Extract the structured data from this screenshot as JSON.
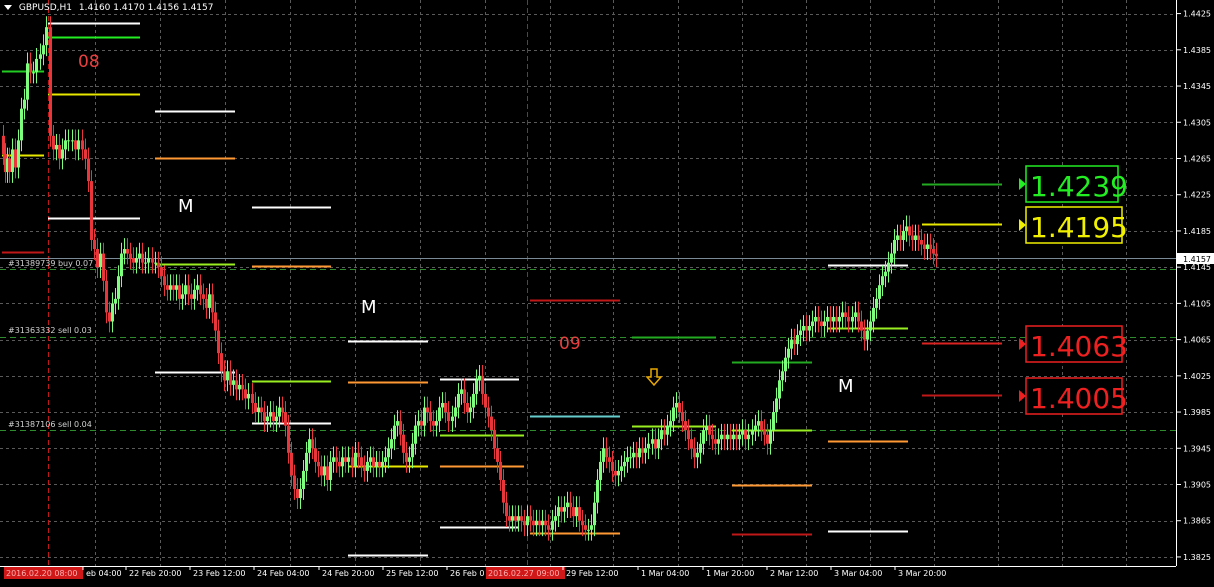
{
  "header": {
    "symbol_tf": "GBPUSD,H1",
    "ohlc": "1.4160 1.4170 1.4156 1.4157"
  },
  "price_axis": {
    "labels": [
      "1.4425",
      "1.4385",
      "1.4345",
      "1.4305",
      "1.4265",
      "1.4225",
      "1.4185",
      "1.4145",
      "1.4105",
      "1.4065",
      "1.4025",
      "1.3985",
      "1.3945",
      "1.3905",
      "1.3865",
      "1.3825"
    ],
    "current_price": "1.4157"
  },
  "time_axis": {
    "labels": [
      "2016.02.20 08:00",
      "eb 04:00",
      "22 Feb 20:00",
      "23 Feb 12:00",
      "24 Feb 04:00",
      "24 Feb 20:00",
      "25 Feb 12:00",
      "26 Feb 0",
      "2016.02.27 09:00",
      "29 Feb 12:00",
      "1 Mar 04:00",
      "1 Mar 20:00",
      "2 Mar 12:00",
      "3 Mar 04:00",
      "3 Mar 20:00"
    ]
  },
  "orders": {
    "buy": "#31389739 buy 0.07",
    "sell1": "#31363332 sell 0.03",
    "sell2": "#31387106 sell 0.04"
  },
  "labels": {
    "week1": "08",
    "week2": "09",
    "m1": "M",
    "m2": "M",
    "m3": "M"
  },
  "price_boxes": {
    "green": "1.4239",
    "yellow": "1.4195",
    "red1": "1.4063",
    "red2": "1.4005"
  },
  "chart_data": {
    "type": "candlestick",
    "symbol": "GBPUSD",
    "timeframe": "H1",
    "ylim": [
      1.3815,
      1.444
    ],
    "current_price": 1.4157,
    "points": [
      [
        1,
        1.429
      ],
      [
        3,
        1.427
      ],
      [
        5,
        1.425
      ],
      [
        7,
        1.4265
      ],
      [
        9,
        1.425
      ],
      [
        12,
        1.4275
      ],
      [
        15,
        1.4255
      ],
      [
        18,
        1.4285
      ],
      [
        21,
        1.432
      ],
      [
        24,
        1.433
      ],
      [
        27,
        1.437
      ],
      [
        30,
        1.436
      ],
      [
        33,
        1.436
      ],
      [
        36,
        1.4375
      ],
      [
        40,
        1.438
      ],
      [
        43,
        1.439
      ],
      [
        46,
        1.441
      ],
      [
        50,
        1.429
      ],
      [
        53,
        1.4275
      ],
      [
        56,
        1.428
      ],
      [
        59,
        1.4265
      ],
      [
        62,
        1.4275
      ],
      [
        65,
        1.4285
      ],
      [
        68,
        1.4285
      ],
      [
        72,
        1.4285
      ],
      [
        75,
        1.4275
      ],
      [
        78,
        1.4285
      ],
      [
        82,
        1.4275
      ],
      [
        85,
        1.4265
      ],
      [
        88,
        1.424
      ],
      [
        91,
        1.4175
      ],
      [
        94,
        1.4165
      ],
      [
        97,
        1.4145
      ],
      [
        100,
        1.416
      ],
      [
        103,
        1.413
      ],
      [
        106,
        1.4095
      ],
      [
        109,
        1.4085
      ],
      [
        112,
        1.4105
      ],
      [
        115,
        1.411
      ],
      [
        118,
        1.4135
      ],
      [
        121,
        1.416
      ],
      [
        124,
        1.4165
      ],
      [
        127,
        1.416
      ],
      [
        130,
        1.4155
      ],
      [
        133,
        1.415
      ],
      [
        136,
        1.4155
      ],
      [
        139,
        1.416
      ],
      [
        142,
        1.415
      ],
      [
        145,
        1.415
      ],
      [
        148,
        1.4155
      ],
      [
        152,
        1.415
      ],
      [
        155,
        1.415
      ],
      [
        158,
        1.4145
      ],
      [
        161,
        1.4135
      ],
      [
        164,
        1.4125
      ],
      [
        167,
        1.412
      ],
      [
        170,
        1.4125
      ],
      [
        173,
        1.412
      ],
      [
        176,
        1.4125
      ],
      [
        179,
        1.411
      ],
      [
        182,
        1.4115
      ],
      [
        185,
        1.4125
      ],
      [
        188,
        1.4115
      ],
      [
        191,
        1.411
      ],
      [
        194,
        1.412
      ],
      [
        197,
        1.4125
      ],
      [
        200,
        1.4115
      ],
      [
        203,
        1.411
      ],
      [
        206,
        1.41
      ],
      [
        209,
        1.4115
      ],
      [
        212,
        1.4095
      ],
      [
        215,
        1.4075
      ],
      [
        218,
        1.405
      ],
      [
        221,
        1.403
      ],
      [
        224,
        1.402
      ],
      [
        227,
        1.403
      ],
      [
        230,
        1.4015
      ],
      [
        233,
        1.402
      ],
      [
        236,
        1.401
      ],
      [
        239,
        1.4015
      ],
      [
        242,
        1.401
      ],
      [
        245,
        1.4
      ],
      [
        248,
        1.4005
      ],
      [
        252,
        1.3995
      ],
      [
        255,
        1.3985
      ],
      [
        258,
        1.399
      ],
      [
        261,
        1.3985
      ],
      [
        264,
        1.3975
      ],
      [
        267,
        1.398
      ],
      [
        270,
        1.3985
      ],
      [
        273,
        1.3975
      ],
      [
        276,
        1.398
      ],
      [
        279,
        1.399
      ],
      [
        282,
        1.3985
      ],
      [
        285,
        1.397
      ],
      [
        288,
        1.394
      ],
      [
        291,
        1.3915
      ],
      [
        294,
        1.39
      ],
      [
        297,
        1.389
      ],
      [
        300,
        1.39
      ],
      [
        303,
        1.392
      ],
      [
        306,
        1.394
      ],
      [
        309,
        1.3955
      ],
      [
        312,
        1.3945
      ],
      [
        315,
        1.393
      ],
      [
        318,
        1.3925
      ],
      [
        321,
        1.3915
      ],
      [
        324,
        1.3925
      ],
      [
        327,
        1.391
      ],
      [
        330,
        1.393
      ],
      [
        333,
        1.3935
      ],
      [
        336,
        1.393
      ],
      [
        339,
        1.3925
      ],
      [
        342,
        1.3935
      ],
      [
        345,
        1.393
      ],
      [
        348,
        1.3935
      ],
      [
        352,
        1.3925
      ],
      [
        355,
        1.394
      ],
      [
        358,
        1.3935
      ],
      [
        361,
        1.3925
      ],
      [
        364,
        1.392
      ],
      [
        367,
        1.393
      ],
      [
        370,
        1.3935
      ],
      [
        373,
        1.3925
      ],
      [
        376,
        1.393
      ],
      [
        379,
        1.3925
      ],
      [
        382,
        1.393
      ],
      [
        385,
        1.3935
      ],
      [
        388,
        1.3945
      ],
      [
        391,
        1.3955
      ],
      [
        394,
        1.397
      ],
      [
        397,
        1.3975
      ],
      [
        400,
        1.396
      ],
      [
        403,
        1.394
      ],
      [
        406,
        1.393
      ],
      [
        409,
        1.3935
      ],
      [
        412,
        1.395
      ],
      [
        415,
        1.397
      ],
      [
        418,
        1.3975
      ],
      [
        421,
        1.397
      ],
      [
        424,
        1.399
      ],
      [
        427,
        1.3985
      ],
      [
        430,
        1.3975
      ],
      [
        433,
        1.397
      ],
      [
        436,
        1.3975
      ],
      [
        439,
        1.399
      ],
      [
        442,
        1.3995
      ],
      [
        445,
        1.3985
      ],
      [
        448,
        1.3975
      ],
      [
        452,
        1.398
      ],
      [
        455,
        1.399
      ],
      [
        458,
        1.4005
      ],
      [
        461,
        1.401
      ],
      [
        464,
        1.3995
      ],
      [
        467,
        1.3985
      ],
      [
        470,
        1.399
      ],
      [
        473,
        1.4005
      ],
      [
        476,
        1.402
      ],
      [
        479,
        1.4025
      ],
      [
        482,
        1.4005
      ],
      [
        485,
        1.399
      ],
      [
        488,
        1.398
      ],
      [
        491,
        1.3965
      ],
      [
        494,
        1.3945
      ],
      [
        497,
        1.393
      ],
      [
        500,
        1.391
      ],
      [
        503,
        1.3885
      ],
      [
        506,
        1.387
      ],
      [
        509,
        1.3865
      ],
      [
        512,
        1.387
      ],
      [
        515,
        1.3865
      ],
      [
        518,
        1.387
      ],
      [
        521,
        1.3865
      ],
      [
        524,
        1.386
      ],
      [
        527,
        1.387
      ],
      [
        530,
        1.3865
      ],
      [
        533,
        1.386
      ],
      [
        536,
        1.3865
      ],
      [
        539,
        1.386
      ],
      [
        542,
        1.3865
      ],
      [
        545,
        1.386
      ],
      [
        548,
        1.3855
      ],
      [
        552,
        1.3865
      ],
      [
        555,
        1.387
      ],
      [
        558,
        1.388
      ],
      [
        561,
        1.3875
      ],
      [
        564,
        1.388
      ],
      [
        567,
        1.3885
      ],
      [
        570,
        1.388
      ],
      [
        573,
        1.387
      ],
      [
        576,
        1.388
      ],
      [
        579,
        1.3865
      ],
      [
        582,
        1.386
      ],
      [
        585,
        1.3855
      ],
      [
        588,
        1.3855
      ],
      [
        591,
        1.386
      ],
      [
        594,
        1.3885
      ],
      [
        597,
        1.391
      ],
      [
        600,
        1.393
      ],
      [
        603,
        1.3945
      ],
      [
        606,
        1.3935
      ],
      [
        609,
        1.393
      ],
      [
        612,
        1.392
      ],
      [
        615,
        1.3915
      ],
      [
        618,
        1.392
      ],
      [
        621,
        1.3925
      ],
      [
        624,
        1.393
      ],
      [
        627,
        1.3935
      ],
      [
        630,
        1.3935
      ],
      [
        633,
        1.394
      ],
      [
        636,
        1.3935
      ],
      [
        639,
        1.3945
      ],
      [
        642,
        1.394
      ],
      [
        645,
        1.3945
      ],
      [
        648,
        1.395
      ],
      [
        652,
        1.3955
      ],
      [
        655,
        1.3945
      ],
      [
        658,
        1.3955
      ],
      [
        661,
        1.3965
      ],
      [
        664,
        1.396
      ],
      [
        667,
        1.397
      ],
      [
        670,
        1.3975
      ],
      [
        673,
        1.399
      ],
      [
        676,
        1.3995
      ],
      [
        679,
        1.3985
      ],
      [
        682,
        1.3975
      ],
      [
        685,
        1.3965
      ],
      [
        688,
        1.3955
      ],
      [
        691,
        1.3945
      ],
      [
        694,
        1.3935
      ],
      [
        697,
        1.394
      ],
      [
        700,
        1.395
      ],
      [
        703,
        1.3965
      ],
      [
        706,
        1.397
      ],
      [
        709,
        1.396
      ],
      [
        712,
        1.3955
      ],
      [
        715,
        1.395
      ],
      [
        718,
        1.3955
      ],
      [
        721,
        1.396
      ],
      [
        724,
        1.3955
      ],
      [
        727,
        1.396
      ],
      [
        730,
        1.3955
      ],
      [
        733,
        1.396
      ],
      [
        736,
        1.3955
      ],
      [
        739,
        1.396
      ],
      [
        742,
        1.3965
      ],
      [
        745,
        1.3955
      ],
      [
        748,
        1.396
      ],
      [
        752,
        1.3965
      ],
      [
        755,
        1.397
      ],
      [
        758,
        1.3975
      ],
      [
        761,
        1.3965
      ],
      [
        764,
        1.396
      ],
      [
        767,
        1.395
      ],
      [
        770,
        1.3965
      ],
      [
        773,
        1.3985
      ],
      [
        776,
        1.4
      ],
      [
        779,
        1.402
      ],
      [
        782,
        1.403
      ],
      [
        785,
        1.4045
      ],
      [
        788,
        1.4055
      ],
      [
        791,
        1.4065
      ],
      [
        794,
        1.406
      ],
      [
        797,
        1.407
      ],
      [
        800,
        1.4075
      ],
      [
        803,
        1.408
      ],
      [
        806,
        1.4075
      ],
      [
        809,
        1.408
      ],
      [
        812,
        1.4085
      ],
      [
        815,
        1.409
      ],
      [
        818,
        1.4085
      ],
      [
        821,
        1.408
      ],
      [
        824,
        1.4085
      ],
      [
        827,
        1.409
      ],
      [
        830,
        1.4085
      ],
      [
        833,
        1.409
      ],
      [
        836,
        1.4085
      ],
      [
        839,
        1.409
      ],
      [
        842,
        1.4095
      ],
      [
        845,
        1.409
      ],
      [
        848,
        1.4085
      ],
      [
        852,
        1.409
      ],
      [
        855,
        1.4095
      ],
      [
        858,
        1.4085
      ],
      [
        861,
        1.4075
      ],
      [
        864,
        1.4065
      ],
      [
        867,
        1.4075
      ],
      [
        870,
        1.4085
      ],
      [
        873,
        1.41
      ],
      [
        876,
        1.411
      ],
      [
        879,
        1.4125
      ],
      [
        882,
        1.4135
      ],
      [
        885,
        1.414
      ],
      [
        888,
        1.415
      ],
      [
        891,
        1.416
      ],
      [
        894,
        1.4175
      ],
      [
        897,
        1.418
      ],
      [
        900,
        1.4175
      ],
      [
        903,
        1.4185
      ],
      [
        906,
        1.419
      ],
      [
        909,
        1.418
      ],
      [
        912,
        1.4175
      ],
      [
        915,
        1.418
      ],
      [
        918,
        1.4175
      ],
      [
        921,
        1.417
      ],
      [
        924,
        1.4165
      ],
      [
        927,
        1.417
      ],
      [
        930,
        1.4165
      ],
      [
        933,
        1.416
      ],
      [
        936,
        1.4157
      ]
    ]
  }
}
